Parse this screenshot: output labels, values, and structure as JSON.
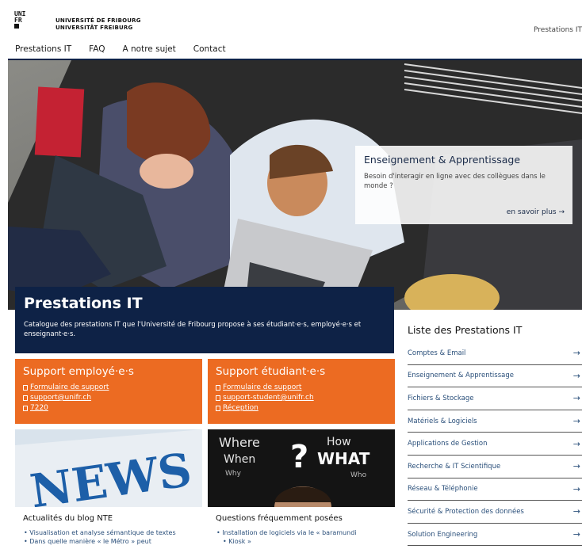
{
  "header": {
    "logo_lines": [
      "UNI",
      "FR"
    ],
    "university_fr": "UNIVERSITÉ DE FRIBOURG",
    "university_de": "UNIVERSITÄT FREIBURG",
    "top_right": "Prestations IT"
  },
  "nav": [
    "Prestations IT",
    "FAQ",
    "A notre sujet",
    "Contact"
  ],
  "hero_card": {
    "title": "Enseignement & Apprentissage",
    "text": "Besoin d'interagir en ligne avec des collègues dans le monde ?",
    "more": "en savoir plus →"
  },
  "title_panel": {
    "title": "Prestations IT",
    "text": "Catalogue des prestations IT que l'Université de Fribourg propose à ses étudiant·e·s, employé·e·s et enseignant·e·s."
  },
  "support_staff": {
    "title": "Support employé·e·s",
    "links": [
      "Formulaire de support",
      "support@unifr.ch",
      "7220"
    ]
  },
  "support_students": {
    "title": "Support étudiant·e·s",
    "links": [
      "Formulaire de support",
      "support-student@unifr.ch",
      "Réception"
    ]
  },
  "news_image_text": "NEWS",
  "faq_image_text": [
    "Where",
    "How",
    "When",
    "WHAT",
    "Why",
    "Who"
  ],
  "blog": {
    "title": "Actualités du blog NTE",
    "items": [
      "Visualisation et analyse sémantique de textes",
      "Dans quelle manière « le Métro » peut"
    ]
  },
  "faq": {
    "title": "Questions fréquemment posées",
    "items": [
      "Installation de logiciels via le « baramundi",
      "Kiosk »"
    ]
  },
  "sidebar": {
    "title": "Liste des Prestations IT",
    "items": [
      "Comptes & Email",
      "Enseignement & Apprentissage",
      "Fichiers & Stockage",
      "Matériels & Logiciels",
      "Applications de Gestion",
      "Recherche & IT Scientifique",
      "Réseau & Téléphonie",
      "Sécurité & Protection des données",
      "Solution Engineering"
    ]
  },
  "colors": {
    "navy": "#0e2246",
    "orange": "#ec6b22",
    "link": "#2a4f7a"
  }
}
